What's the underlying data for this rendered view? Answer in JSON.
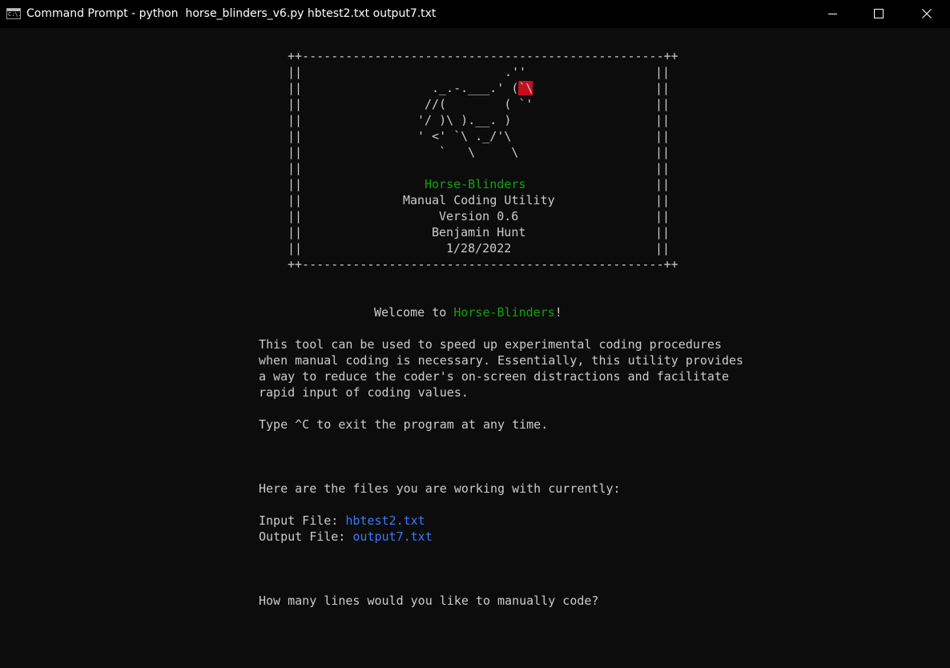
{
  "window": {
    "title": "Command Prompt - python  horse_blinders_v6.py hbtest2.txt output7.txt",
    "icon_label": "C:\\."
  },
  "colors": {
    "background": "#0c0c0c",
    "text": "#cccccc",
    "green": "#13a10e",
    "blue": "#3b78ff",
    "red": "#c50f1f"
  },
  "banner": {
    "border_top": "++--------------------------------------------------++",
    "border_bottom": "++--------------------------------------------------++",
    "side": "||",
    "art": [
      ".''",
      "._.-.___.' (",
      "`\\",
      "//(        ( `'",
      "'/ )\\ ).__. )",
      "' <' `\\ ._/'\\",
      "`   \\     \\"
    ],
    "name": "Horse-Blinders",
    "subtitle": "Manual Coding Utility",
    "version": "Version 0.6",
    "author": "Benjamin Hunt",
    "date": "1/28/2022"
  },
  "welcome": {
    "prefix": "Welcome to ",
    "name": "Horse-Blinders",
    "suffix": "!"
  },
  "description": [
    "This tool can be used to speed up experimental coding procedures",
    "when manual coding is necessary. Essentially, this utility provides",
    "a way to reduce the coder's on-screen distractions and facilitate",
    "rapid input of coding values."
  ],
  "exit_hint": "Type ^C to exit the program at any time.",
  "files": {
    "heading": "Here are the files you are working with currently:",
    "input_label": "Input File: ",
    "input_value": "hbtest2.txt",
    "output_label": "Output File: ",
    "output_value": "output7.txt"
  },
  "prompt": "How many lines would you like to manually code?"
}
